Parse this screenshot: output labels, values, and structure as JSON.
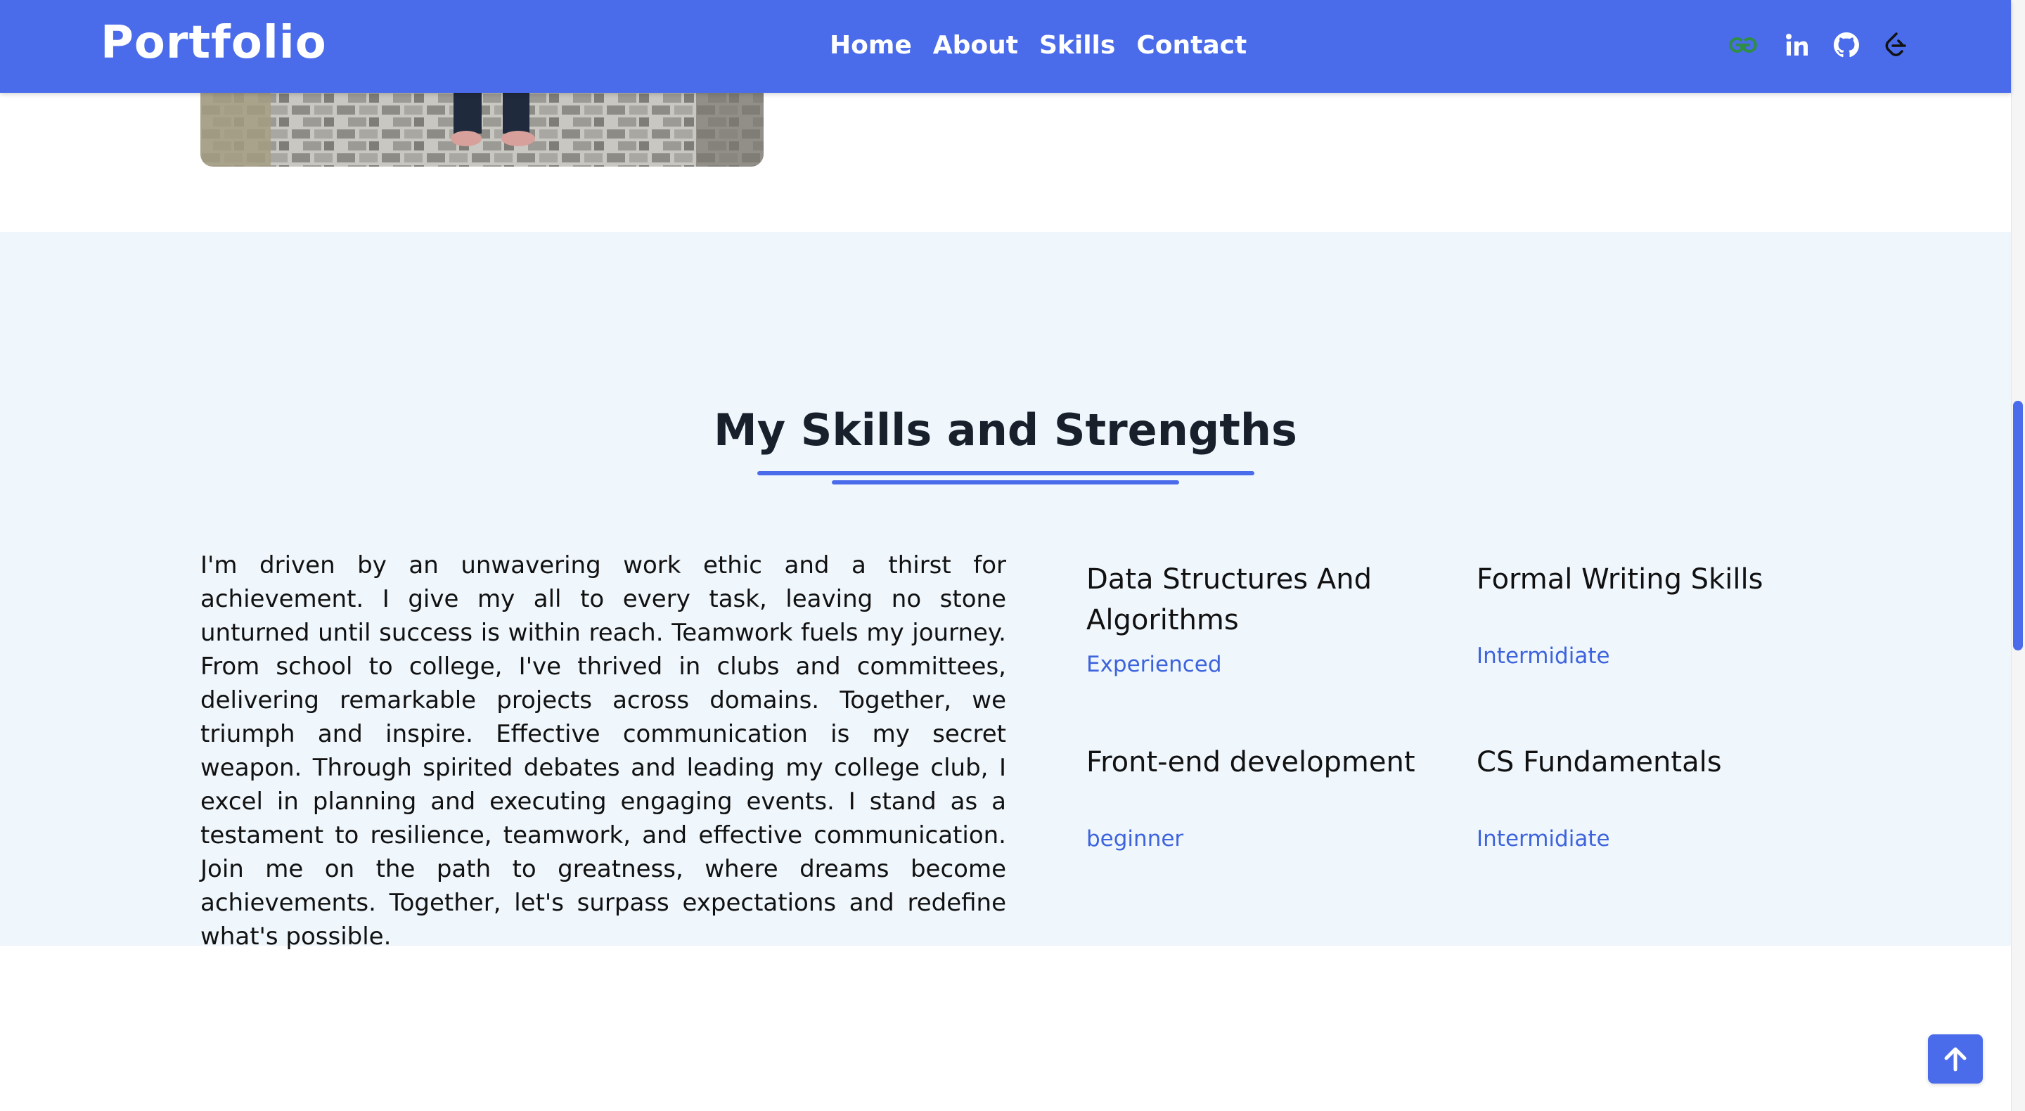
{
  "navbar": {
    "brand": "Portfolio",
    "links": [
      "Home",
      "About",
      "Skills",
      "Contact"
    ],
    "icons": [
      "geeksforgeeks-icon",
      "linkedin-icon",
      "github-icon",
      "leetcode-icon"
    ],
    "background": "#4a6cea"
  },
  "skills": {
    "title": "My Skills and Strengths",
    "paragraph": "I'm driven by an unwavering work ethic and a thirst for achievement. I give my all to every task, leaving no stone unturned until success is within reach. Teamwork fuels my journey. From school to college, I've thrived in clubs and committees, delivering remarkable projects across domains. Together, we triumph and inspire. Effective communication is my secret weapon. Through spirited debates and leading my college club, I excel in planning and executing engaging events. I stand as a testament to resilience, teamwork, and effective communication. Join me on the path to greatness, where dreams become achievements. Together, let's surpass expectations and redefine what's possible.",
    "items": [
      {
        "name": "Data Structures And Algorithms",
        "level": "Experienced"
      },
      {
        "name": "Formal Writing Skills",
        "level": "Intermidiate"
      },
      {
        "name": "Front-end development",
        "level": "beginner"
      },
      {
        "name": "CS Fundamentals",
        "level": "Intermidiate"
      }
    ],
    "background": "#eff6fc",
    "accent": "#4a6cea",
    "level_color": "#3d63dd"
  },
  "scroll_top": {
    "icon": "arrow-up-icon"
  },
  "scrollbar": {
    "thumb_color": "#4a6cea"
  }
}
